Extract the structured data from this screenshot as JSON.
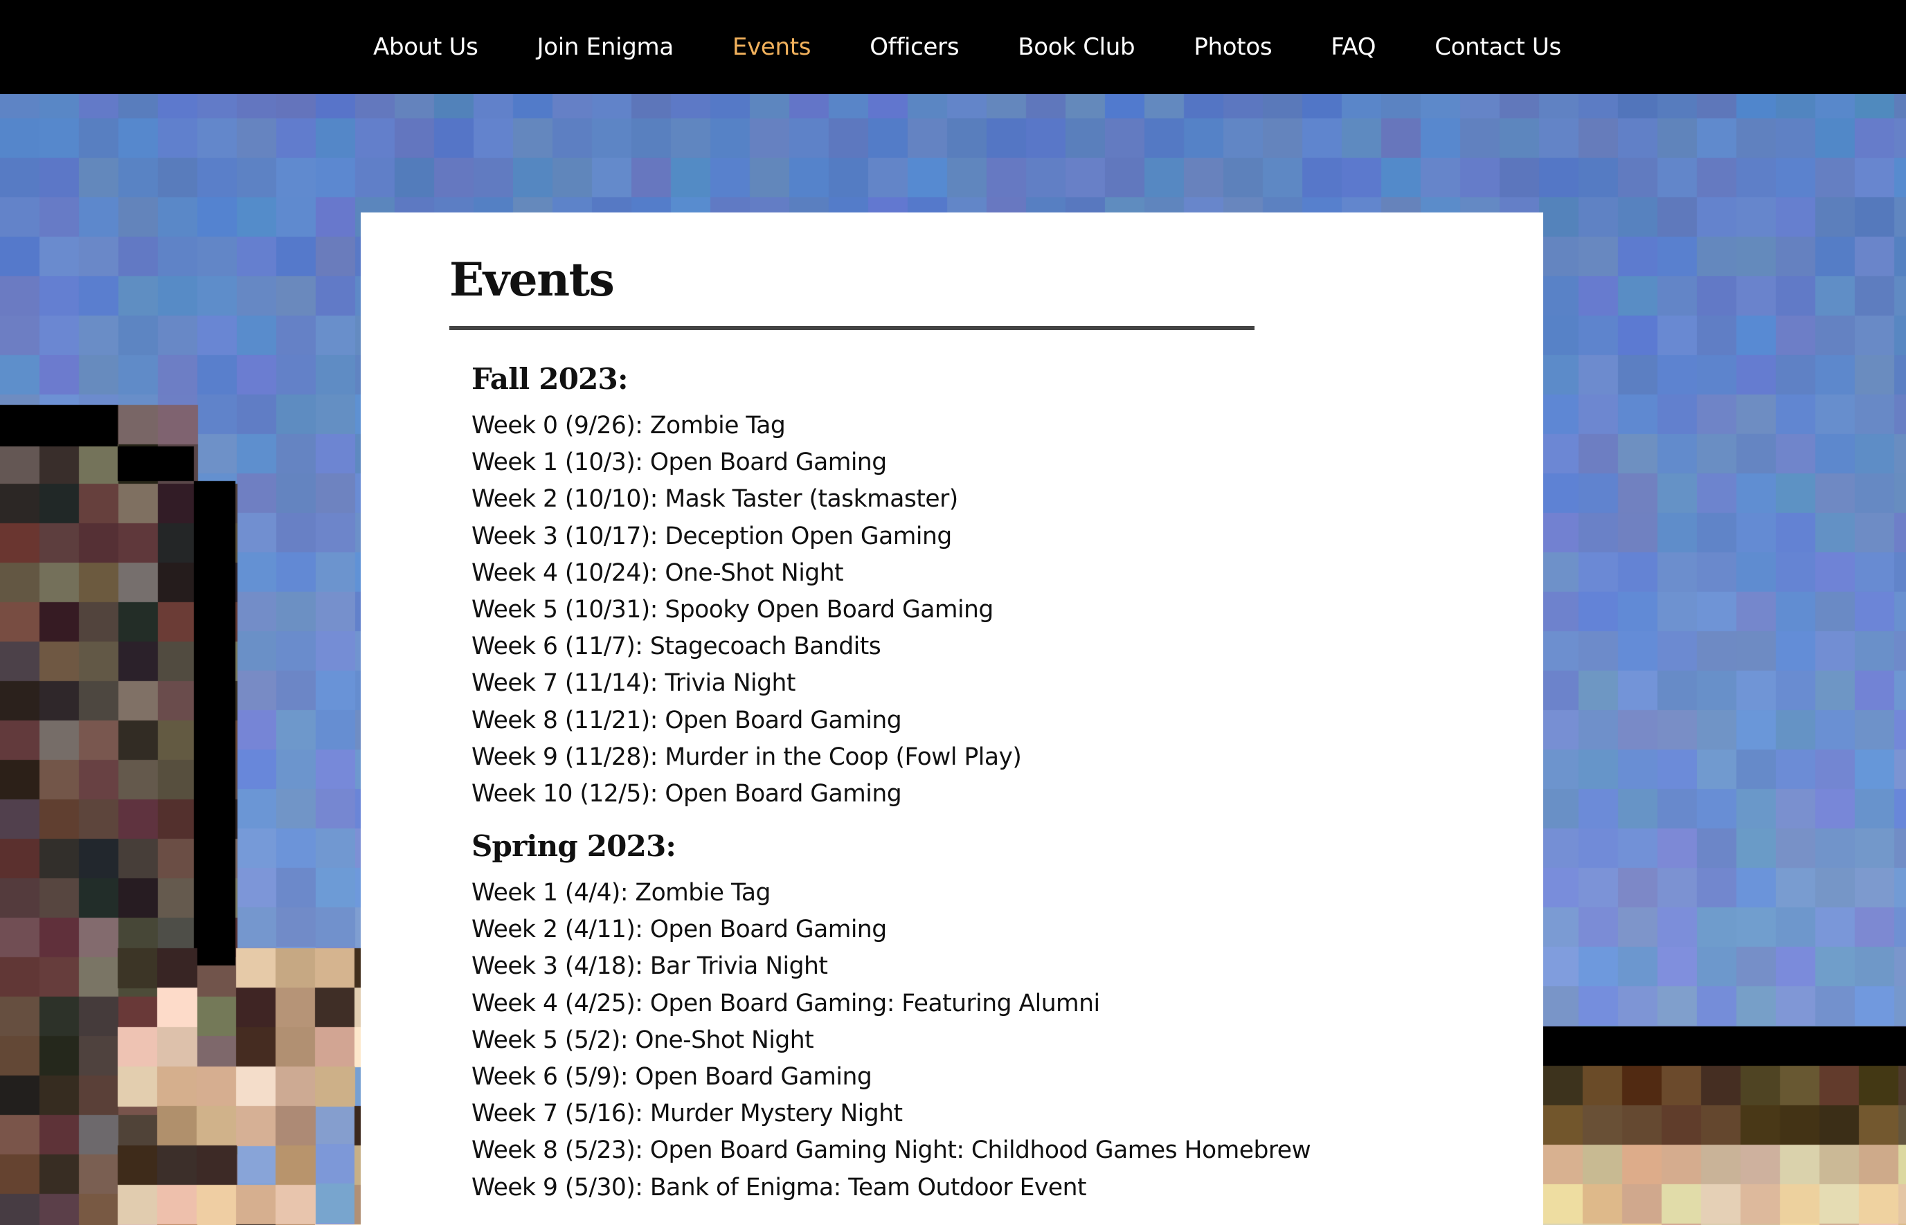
{
  "nav": {
    "items": [
      {
        "label": "About Us",
        "active": false
      },
      {
        "label": "Join Enigma",
        "active": false
      },
      {
        "label": "Events",
        "active": true
      },
      {
        "label": "Officers",
        "active": false
      },
      {
        "label": "Book Club",
        "active": false
      },
      {
        "label": "Photos",
        "active": false
      },
      {
        "label": "FAQ",
        "active": false
      },
      {
        "label": "Contact Us",
        "active": false
      }
    ],
    "active_color": "#f1b15c"
  },
  "page": {
    "title": "Events"
  },
  "seasons": [
    {
      "heading": "Fall 2023:",
      "events": [
        "Week 0 (9/26): Zombie Tag",
        "Week 1 (10/3): Open Board Gaming",
        "Week 2 (10/10): Mask Taster (taskmaster)",
        "Week 3 (10/17): Deception Open Gaming",
        "Week 4 (10/24): One-Shot Night",
        "Week 5 (10/31): Spooky Open Board Gaming",
        "Week 6 (11/7): Stagecoach Bandits",
        "Week 7 (11/14): Trivia Night",
        "Week 8 (11/21): Open Board Gaming",
        "Week 9 (11/28): Murder in the Coop (Fowl Play)",
        "Week 10 (12/5): Open Board Gaming"
      ]
    },
    {
      "heading": "Spring 2023:",
      "events": [
        "Week 1 (4/4): Zombie Tag",
        "Week 2 (4/11): Open Board Gaming",
        "Week 3 (4/18): Bar Trivia Night",
        "Week 4 (4/25): Open Board Gaming: Featuring Alumni",
        "Week 5 (5/2): One-Shot Night",
        "Week 6 (5/9): Open Board Gaming",
        "Week 7 (5/16): Murder Mystery Night",
        "Week 8 (5/23): Open Board Gaming Night: Childhood Games Homebrew",
        "Week 9 (5/30): Bank of Enigma: Team Outdoor Event"
      ]
    }
  ]
}
